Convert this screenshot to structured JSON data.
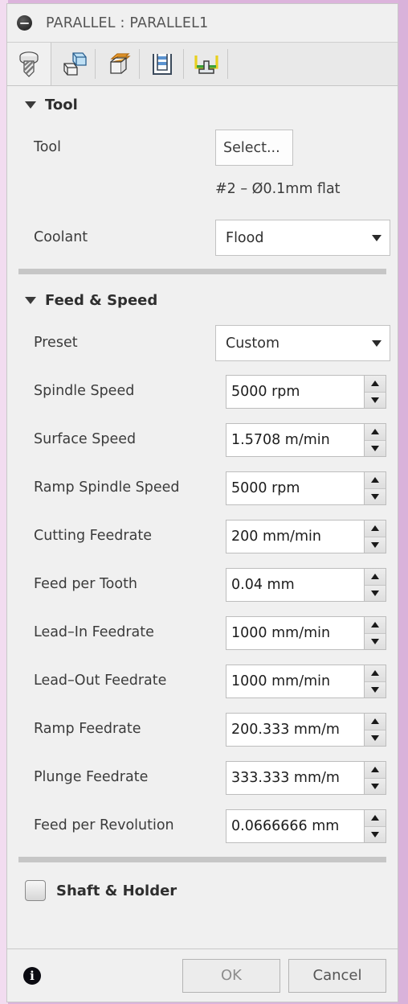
{
  "window": {
    "title": "PARALLEL : PARALLEL1",
    "close_icon": "minus-circle-icon"
  },
  "tabs": [
    {
      "name": "tool-tab",
      "icon": "screw-tool-icon",
      "active": true
    },
    {
      "name": "geometry-tab",
      "icon": "blue-cubes-icon",
      "active": false
    },
    {
      "name": "heights-tab",
      "icon": "orange-top-cube-icon",
      "active": false
    },
    {
      "name": "passes-tab",
      "icon": "layers-stock-icon",
      "active": false
    },
    {
      "name": "linking-tab",
      "icon": "green-yellow-boundary-icon",
      "active": false
    }
  ],
  "sections": {
    "tool": {
      "title": "Tool",
      "collapse_icon": "triangle-down-icon",
      "tool_label": "Tool",
      "select_button": "Select...",
      "tool_note": "#2 – Ø0.1mm flat",
      "coolant_label": "Coolant",
      "coolant_value": "Flood"
    },
    "feed_speed": {
      "title": "Feed & Speed",
      "collapse_icon": "triangle-down-icon",
      "preset_label": "Preset",
      "preset_value": "Custom",
      "fields": [
        {
          "label": "Spindle Speed",
          "value": "5000 rpm"
        },
        {
          "label": "Surface Speed",
          "value": "1.5708 m/min"
        },
        {
          "label": "Ramp Spindle Speed",
          "value": "5000 rpm"
        },
        {
          "label": "Cutting Feedrate",
          "value": "200 mm/min"
        },
        {
          "label": "Feed per Tooth",
          "value": "0.04 mm"
        },
        {
          "label": "Lead–In Feedrate",
          "value": "1000 mm/min"
        },
        {
          "label": "Lead–Out Feedrate",
          "value": "1000 mm/min"
        },
        {
          "label": "Ramp Feedrate",
          "value": "200.333 mm/m"
        },
        {
          "label": "Plunge Feedrate",
          "value": "333.333 mm/m"
        },
        {
          "label": "Feed per Revolution",
          "value": "0.0666666 mm"
        }
      ]
    },
    "shaft_holder": {
      "title": "Shaft & Holder",
      "checked": false
    }
  },
  "footer": {
    "info_icon": "info-circle-icon",
    "info_glyph": "i",
    "ok_label": "OK",
    "cancel_label": "Cancel"
  },
  "colors": {
    "desktop": "#dcb4dc",
    "window_bg": "#f0f0f0",
    "separator": "#c6c6c6",
    "text": "#3b3b3b"
  }
}
